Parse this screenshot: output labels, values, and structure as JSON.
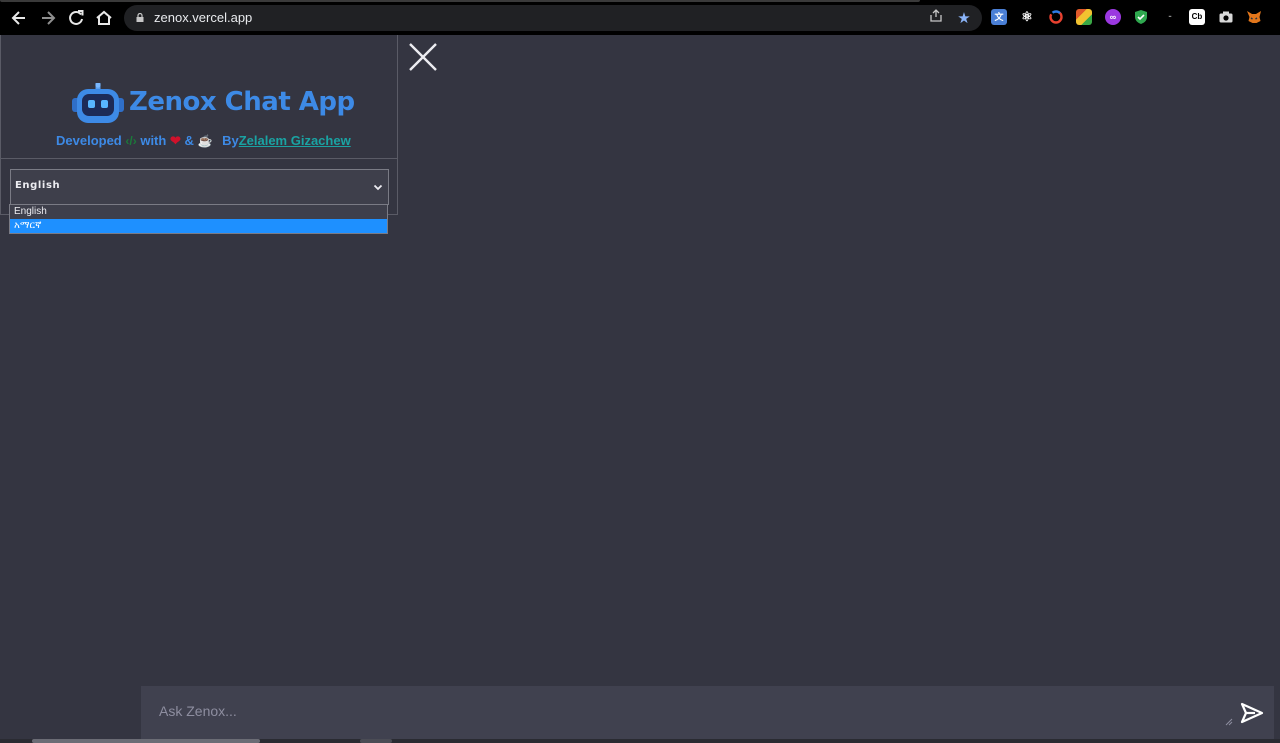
{
  "browser": {
    "url": "zenox.vercel.app",
    "nav_icons": [
      "back-arrow-icon",
      "forward-arrow-icon",
      "reload-icon",
      "home-icon"
    ],
    "omnibox_icons": [
      "share-icon",
      "bookmark-star-icon"
    ],
    "extensions": [
      {
        "name": "google-translate-extension-icon",
        "color": "#4a7fd6",
        "glyph": "文"
      },
      {
        "name": "react-devtools-extension-icon",
        "color": "#000000",
        "glyph": "⚛"
      },
      {
        "name": "refresh-ring-extension-icon",
        "color": "#000000",
        "glyph": "◔"
      },
      {
        "name": "colorful-grid-extension-icon",
        "color": "#e05a2b",
        "glyph": "▦"
      },
      {
        "name": "purple-circle-extension-icon",
        "color": "#9b38e0",
        "glyph": "∞"
      },
      {
        "name": "shield-extension-icon",
        "color": "#000000",
        "glyph": "✓"
      },
      {
        "name": "cb-extension-icon",
        "color": "#ffffff",
        "glyph": "Cb"
      },
      {
        "name": "camera-extension-icon",
        "color": "#000000",
        "glyph": "◉"
      },
      {
        "name": "metamask-extension-icon",
        "color": "#e2761b",
        "glyph": "🦊"
      }
    ]
  },
  "sidebar": {
    "app_title": "Zenox Chat App",
    "credits": {
      "developed": "Developed",
      "with": "with",
      "amp": "&",
      "by": "By",
      "author": "Zelalem Gizachew"
    },
    "language_select": {
      "value": "English",
      "options": [
        "English",
        "አማርኛ"
      ],
      "highlighted_index": 1
    }
  },
  "chat": {
    "placeholder": "Ask Zenox..."
  },
  "colors": {
    "background": "#343541",
    "brand_blue": "#3d8ae6",
    "author_teal": "#1aa3a3",
    "highlight": "#1e90ff",
    "input_bg": "#40414f"
  }
}
